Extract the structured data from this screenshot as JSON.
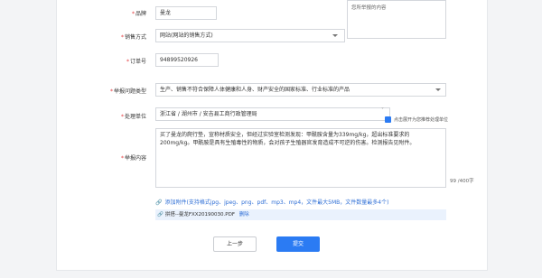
{
  "form": {
    "brand": {
      "label": "品牌",
      "value": "曼龙"
    },
    "hint_box": {
      "text": "您所举报的内容"
    },
    "sales_method": {
      "label": "销售方式",
      "value": "网站(网站的销售方式)"
    },
    "order_no": {
      "label": "订单号",
      "value": "94899520926"
    },
    "issue_type": {
      "label": "举报问题类型",
      "value": "生产、销售不符合保障人体健康和人身、财产安全的国家标准、行业标准的产品"
    },
    "handler": {
      "label": "处理单位",
      "value": "浙江省 / 湖州市 / 安吉县工商行政管理局",
      "checkbox_label": "点击展开为您推荐处理单位"
    },
    "content": {
      "label": "举报内容",
      "text": "买了曼龙的爬行垫，宣称材质安全，但经过实验室检测发现：甲酰胺含量为339mg/kg，超出标准要求的200mg/kg。甲酰胺是具有生殖毒性的物质，会对孩子生殖器官发育造成不可逆的伤害。检测报告见附件。",
      "counter": "99 /400字"
    },
    "attachment": {
      "add_label": "添加附件(支持格式jpg、jpeg、png、pdf、mp3、mp4，文件最大5MB，文件数量最多4个)",
      "file_name": "拼搭--曼龙FXX20190030.PDF",
      "delete_label": "删除"
    }
  },
  "buttons": {
    "prev": "上一步",
    "submit": "提交"
  },
  "colors": {
    "required": "#e4393c",
    "primary": "#2b7bf3",
    "link": "#2f6fd6",
    "file_bg": "#eaf2fd"
  },
  "icons": {
    "attach": "paperclip-icon",
    "select": "chevron-down-icon",
    "checkbox": "checkbox-icon"
  }
}
